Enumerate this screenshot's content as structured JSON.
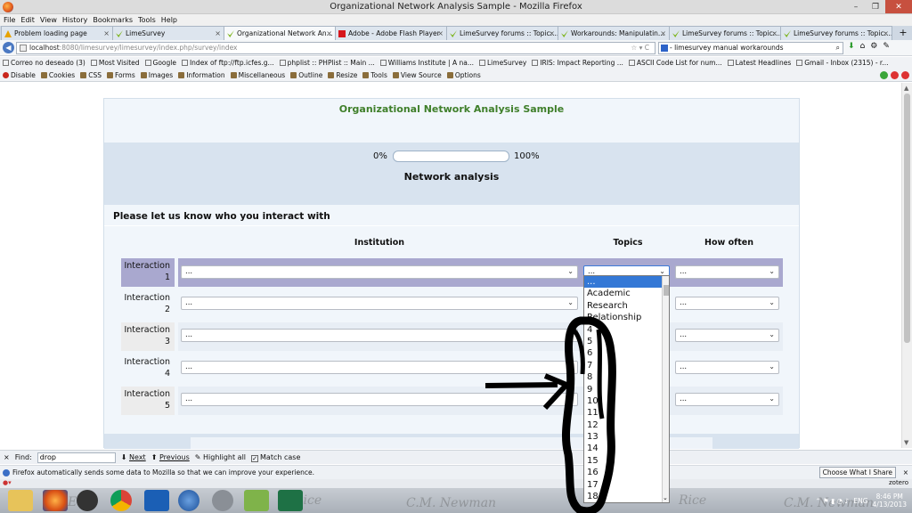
{
  "window": {
    "title": "Organizational Network Analysis Sample - Mozilla Firefox",
    "controls": [
      "–",
      "❐",
      "✕"
    ]
  },
  "menubar": [
    "File",
    "Edit",
    "View",
    "History",
    "Bookmarks",
    "Tools",
    "Help"
  ],
  "tabs": [
    {
      "label": "Problem loading page",
      "icon": "warning-icon",
      "active": false
    },
    {
      "label": "LimeSurvey",
      "icon": "limesurvey-icon",
      "active": false
    },
    {
      "label": "Organizational Network An...",
      "icon": "limesurvey-icon",
      "active": true
    },
    {
      "label": "Adobe - Adobe Flash Player",
      "icon": "adobe-icon",
      "active": false
    },
    {
      "label": "LimeSurvey forums :: Topic:...",
      "icon": "limesurvey-icon",
      "active": false
    },
    {
      "label": "Workarounds: Manipulatin...",
      "icon": "limesurvey-icon",
      "active": false
    },
    {
      "label": "LimeSurvey forums :: Topic:...",
      "icon": "limesurvey-icon",
      "active": false
    },
    {
      "label": "LimeSurvey forums :: Topic:...",
      "icon": "limesurvey-icon",
      "active": false
    }
  ],
  "navbar": {
    "url_host": "localhost",
    "url_rest": ":8080/limesurvey/limesurvey/index.php/survey/index",
    "url_controls": "☆ ▾ C",
    "search_value": "- limesurvey manual workarounds"
  },
  "bookmarks": [
    "Correo no deseado (3)",
    "Most Visited",
    "Google",
    "Index of ftp://ftp.icfes.g...",
    "phplist :: PHPlist :: Main ...",
    "Williams Institute | A na...",
    "LimeSurvey",
    "IRIS: Impact Reporting ...",
    "ASCII Code List for num...",
    "Latest Headlines",
    "Gmail - Inbox (2315) - r..."
  ],
  "devtoolbar": [
    "Disable",
    "Cookies",
    "CSS",
    "Forms",
    "Images",
    "Information",
    "Miscellaneous",
    "Outline",
    "Resize",
    "Tools",
    "View Source",
    "Options"
  ],
  "survey": {
    "title": "Organizational Network Analysis Sample",
    "progress_left": "0%",
    "progress_right": "100%",
    "progress_fraction": 0.0,
    "group_title": "Network analysis",
    "question": "Please let us know who you interact with",
    "columns": [
      "Institution",
      "Topics",
      "How often"
    ],
    "rows": [
      {
        "label_a": "Interaction",
        "label_b": "1",
        "institution": "...",
        "topics": "...",
        "often": "..."
      },
      {
        "label_a": "Interaction",
        "label_b": "2",
        "institution": "...",
        "topics": "",
        "often": "..."
      },
      {
        "label_a": "Interaction",
        "label_b": "3",
        "institution": "...",
        "topics": "",
        "often": "..."
      },
      {
        "label_a": "Interaction",
        "label_b": "4",
        "institution": "...",
        "topics": "",
        "often": "..."
      },
      {
        "label_a": "Interaction",
        "label_b": "5",
        "institution": "...",
        "topics": "",
        "often": "..."
      }
    ],
    "dropdown_options": [
      "...",
      "Academic",
      "Research",
      "Relationship",
      "4",
      "5",
      "6",
      "7",
      "8",
      "9",
      "10",
      "11",
      "12",
      "13",
      "14",
      "15",
      "16",
      "17",
      "18"
    ],
    "highlighted_option": "..."
  },
  "findbar": {
    "label": "Find:",
    "value": "drop",
    "next": "Next",
    "previous": "Previous",
    "highlight": "Highlight all",
    "match_case": "Match case"
  },
  "notification": {
    "text": "Firefox automatically sends some data to Mozilla so that we can improve your experience.",
    "button": "Choose What I Share"
  },
  "addonbar": {
    "right": "zotero"
  },
  "taskbar": {
    "lang": "ENG",
    "time": "8:46 PM",
    "date": "4/13/2013"
  },
  "colors": {
    "survey_title": "#3f7f2a",
    "row_highlight": "#a9a8cf",
    "band": "#d8e3ef"
  }
}
